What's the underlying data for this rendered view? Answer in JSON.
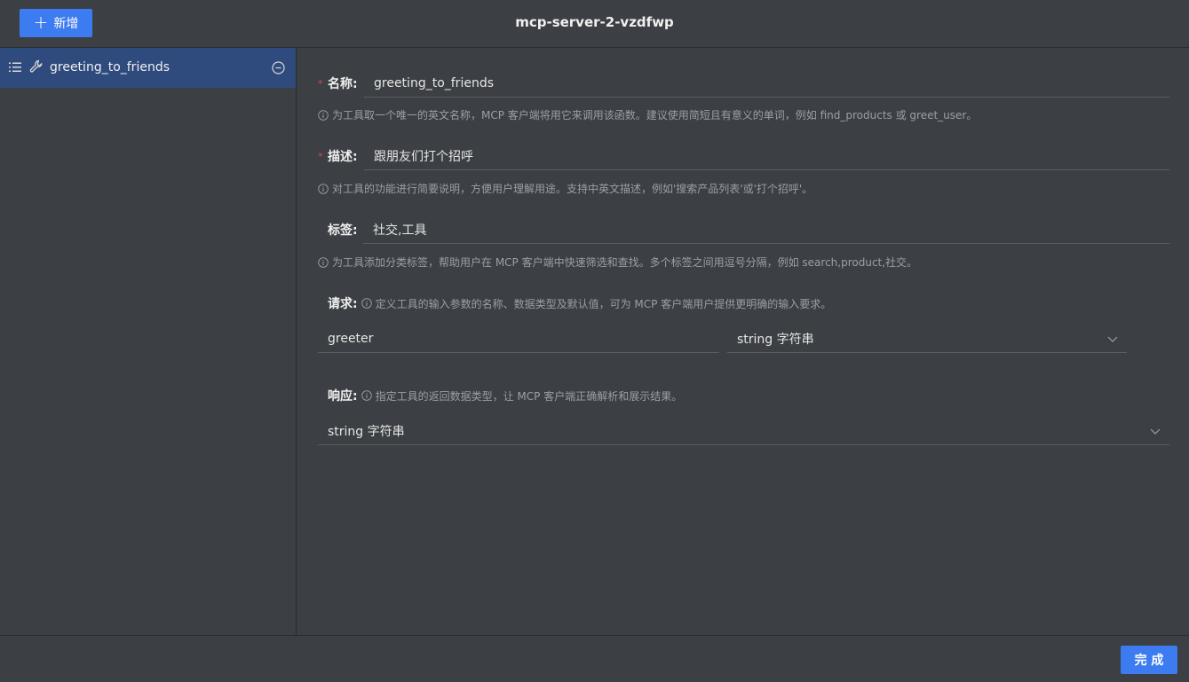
{
  "header": {
    "add_label": "新增",
    "title": "mcp-server-2-vzdfwp"
  },
  "sidebar": {
    "items": [
      {
        "label": "greeting_to_friends"
      }
    ]
  },
  "form": {
    "name": {
      "label": "名称:",
      "value": "greeting_to_friends",
      "hint": "为工具取一个唯一的英文名称，MCP 客户端将用它来调用该函数。建议使用简短且有意义的单词，例如 find_products 或 greet_user。"
    },
    "description": {
      "label": "描述:",
      "value": "跟朋友们打个招呼",
      "hint": "对工具的功能进行简要说明，方便用户理解用途。支持中英文描述，例如'搜索产品列表'或'打个招呼'。"
    },
    "tags": {
      "label": "标签:",
      "value": "社交,工具",
      "hint": "为工具添加分类标签，帮助用户在 MCP 客户端中快速筛选和查找。多个标签之间用逗号分隔，例如 search,product,社交。"
    },
    "request": {
      "label": "请求:",
      "hint": "定义工具的输入参数的名称、数据类型及默认值，可为 MCP 客户端用户提供更明确的输入要求。",
      "param_name": "greeter",
      "param_type": "string 字符串"
    },
    "response": {
      "label": "响应:",
      "hint": "指定工具的返回数据类型，让 MCP 客户端正确解析和展示结果。",
      "type": "string 字符串"
    }
  },
  "footer": {
    "done_label": "完 成"
  },
  "colors": {
    "accent": "#3d7bf0",
    "background": "#3c3f43",
    "selected": "#2f4b7e",
    "required": "#e04848"
  }
}
